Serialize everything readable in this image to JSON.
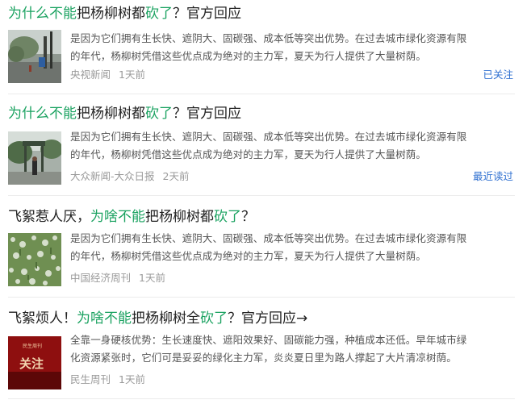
{
  "results": [
    {
      "title_parts": [
        {
          "text": "为什么不能",
          "hl": true
        },
        {
          "text": "把杨柳树都",
          "hl": false
        },
        {
          "text": "砍了",
          "hl": true
        },
        {
          "text": "？官方回应",
          "hl": false
        }
      ],
      "snippet_lines": [
        "是因为它们拥有生长快、遮阴大、固碳强、成本低等突出优势。在过去城市绿化资源有限",
        "的年代，杨柳树凭借这些优点成为绝对的主力军，夏天为行人提供了大量树荫。"
      ],
      "source": "央视新闻",
      "time": "1天前",
      "status": "已关注"
    },
    {
      "title_parts": [
        {
          "text": "为什么不能",
          "hl": true
        },
        {
          "text": "把杨柳树都",
          "hl": false
        },
        {
          "text": "砍了",
          "hl": true
        },
        {
          "text": "？官方回应",
          "hl": false
        }
      ],
      "snippet_lines": [
        "是因为它们拥有生长快、遮阴大、固碳强、成本低等突出优势。在过去城市绿化资源有限",
        "的年代，杨柳树凭借这些优点成为绝对的主力军，夏天为行人提供了大量树荫。"
      ],
      "source": "大众新闻-大众日报",
      "time": "2天前",
      "status": "最近读过"
    },
    {
      "title_parts": [
        {
          "text": "飞絮惹人厌，",
          "hl": false
        },
        {
          "text": "为啥不能",
          "hl": true
        },
        {
          "text": "把杨柳树都",
          "hl": false
        },
        {
          "text": "砍了",
          "hl": true
        },
        {
          "text": "？",
          "hl": false
        }
      ],
      "snippet_lines": [
        "是因为它们拥有生长快、遮阴大、固碳强、成本低等突出优势。在过去城市绿化资源有限",
        "的年代，杨柳树凭借这些优点成为绝对的主力军，夏天为行人提供了大量树荫。"
      ],
      "source": "中国经济周刊",
      "time": "1天前",
      "status": ""
    },
    {
      "title_parts": [
        {
          "text": "飞絮烦人！",
          "hl": false
        },
        {
          "text": "为啥不能",
          "hl": true
        },
        {
          "text": "把杨柳树全",
          "hl": false
        },
        {
          "text": "砍了",
          "hl": true
        },
        {
          "text": "？官方回应→",
          "hl": false
        }
      ],
      "snippet_lines": [
        "全靠一身硬核优势：生长速度快、遮阳效果好、固碳能力强，种植成本还低。早年城市绿",
        "化资源紧张时，它们可是妥妥的绿化主力军，炎炎夏日里为路人撑起了大片清凉树荫。"
      ],
      "source": "民生周刊",
      "time": "1天前",
      "status": "",
      "thumb_text": "关注",
      "thumb_small_text": "民生周刊"
    }
  ],
  "colors": {
    "highlight": "#1aa260",
    "status": "#2e6fd0"
  }
}
